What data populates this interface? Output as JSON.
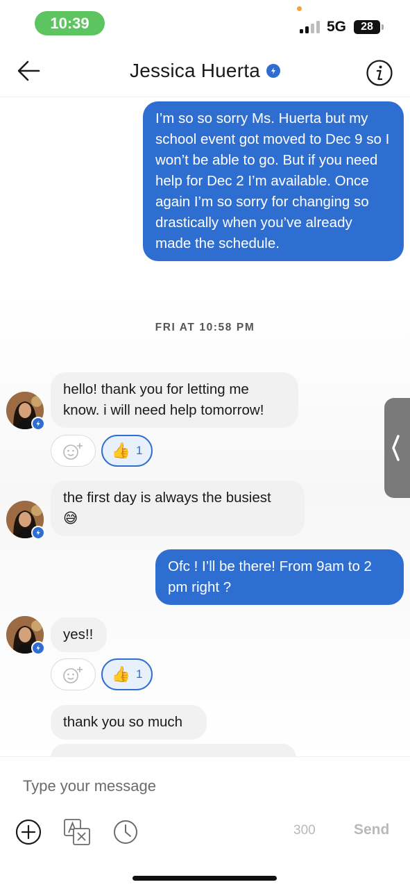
{
  "status_bar": {
    "time": "10:39",
    "network": "5G",
    "battery": "28"
  },
  "header": {
    "contact_name": "Jessica Huerta",
    "back_icon": "arrow-left-icon",
    "info_icon": "info-icon"
  },
  "messages": [
    {
      "direction": "outgoing",
      "text": "I’m so so sorry Ms. Huerta but my school event got moved to Dec 9 so I won’t be able to go. But if you need help for Dec 2 I’m available. Once again I’m so sorry for changing so drastically when you’ve already made the schedule."
    },
    {
      "direction": "incoming",
      "text": "hello! thank you for letting me know. i will need help tomorrow!",
      "reaction": {
        "emoji": "👍",
        "count": "1"
      }
    },
    {
      "direction": "incoming",
      "text": "the first day is always the busiest",
      "emoji": "😅"
    },
    {
      "direction": "outgoing",
      "text": "Ofc ! I’ll be there! From 9am to 2 pm right ?"
    },
    {
      "direction": "incoming",
      "text": "yes!!",
      "reaction": {
        "emoji": "👍",
        "count": "1"
      }
    },
    {
      "direction": "incoming",
      "text": "thank you so much"
    }
  ],
  "divider": {
    "text": "FRI AT 10:58 PM"
  },
  "composer": {
    "placeholder": "Type your message",
    "char_limit": "300",
    "send_label": "Send"
  },
  "colors": {
    "accent": "#2f6ed1",
    "incoming_bubble": "#f1f1f1",
    "status_green": "#5cc55f"
  }
}
